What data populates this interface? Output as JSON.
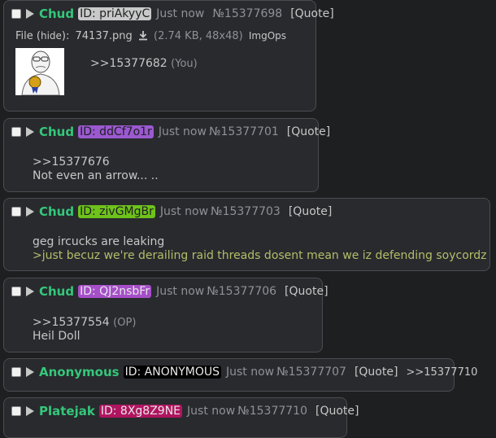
{
  "posts": [
    {
      "name": "Chud",
      "id_label": "ID: priAkyyC",
      "id_bg": "#c9c9c9",
      "id_fg": "#1d1f21",
      "time": "Just now",
      "no": "№15377698",
      "quote": "[Quote]",
      "file": {
        "prefix": "File (",
        "hide": "hide",
        "suffix": "):",
        "filename": "74137.png",
        "info": "(2.74 KB, 48x48)",
        "imgops": "ImgOps"
      },
      "ref": ">>15377682",
      "ref_note": "(You)"
    },
    {
      "name": "Chud",
      "id_label": "ID: ddCf7o1r",
      "id_bg": "#9b59d0",
      "id_fg": "#1d1f21",
      "time": "Just now",
      "no": "№15377701",
      "quote": "[Quote]",
      "ref": ">>15377676",
      "text": "Not even an arrow... .."
    },
    {
      "name": "Chud",
      "id_label": "ID: zivGMgBr",
      "id_bg": "#6ec21b",
      "id_fg": "#1d1f21",
      "time": "Just now",
      "no": "№15377703",
      "quote": "[Quote]",
      "text": "geg ircucks are leaking",
      "greentext": ">just becuz we're derailing raid threads dosent mean we iz defending soycordz"
    },
    {
      "name": "Chud",
      "id_label": "ID: QJ2nsbFr",
      "id_bg": "#a64fc9",
      "id_fg": "#e8e8e8",
      "time": "Just now",
      "no": "№15377706",
      "quote": "[Quote]",
      "ref": ">>15377554",
      "ref_note": "(OP)",
      "text": "Heil Doll"
    },
    {
      "name": "Anonymous",
      "id_label": "ID: ANONYMOUS",
      "id_bg": "#000000",
      "id_fg": "#e8e8e8",
      "time": "Just now",
      "no": "№15377707",
      "quote": "[Quote]",
      "backlink": ">>15377710"
    },
    {
      "name": "Platejak",
      "id_label": "ID: 8Xg8Z9NE",
      "id_bg": "#b01560",
      "id_fg": "#e8e8e8",
      "time": "Just now",
      "no": "№15377710",
      "quote": "[Quote]"
    }
  ]
}
